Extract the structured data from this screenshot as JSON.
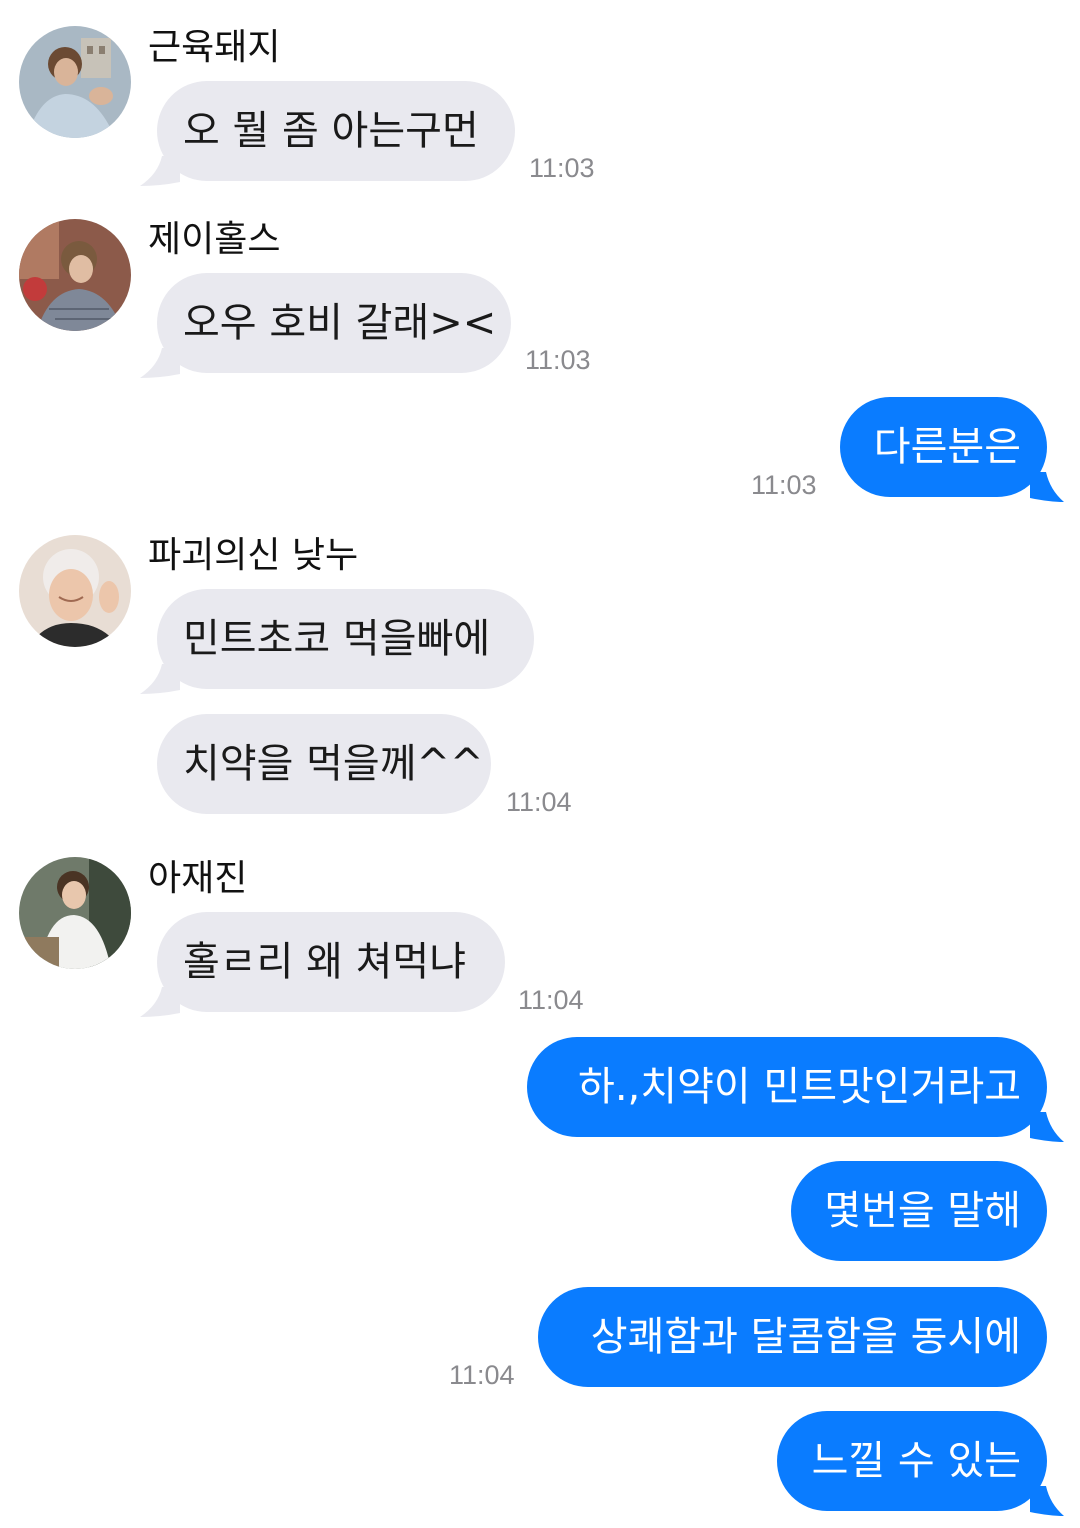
{
  "messages": {
    "g1": {
      "sender": "근육돼지",
      "texts": [
        "오 뭘 좀 아는구먼"
      ],
      "time": "11:03"
    },
    "g2": {
      "sender": "제이홀스",
      "texts": [
        "오우 호비 갈래><"
      ],
      "time": "11:03"
    },
    "o1": {
      "texts": [
        "다른분은"
      ],
      "time": "11:03"
    },
    "g3": {
      "sender": "파괴의신 낮누",
      "texts": [
        "민트초코 먹을빠에",
        "치약을 먹을께^^"
      ],
      "time": "11:04"
    },
    "g4": {
      "sender": "아재진",
      "texts": [
        "홀ㄹ리 왜 쳐먹냐"
      ],
      "time": "11:04"
    },
    "o2": {
      "texts": [
        "하.,치약이 민트맛인거라고",
        "몇번을 말해",
        "상쾌함과 달콤함을 동시에",
        "느낄 수 있는"
      ],
      "time": "11:04"
    }
  },
  "colors": {
    "incoming_bubble": "#e9e9ef",
    "outgoing_bubble": "#0a7cff",
    "timestamp": "#8a8a8e"
  }
}
